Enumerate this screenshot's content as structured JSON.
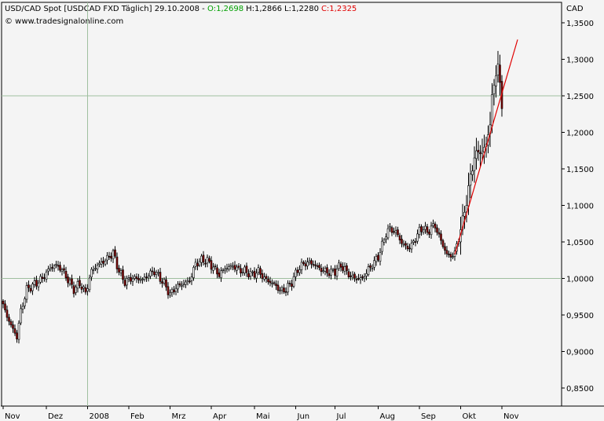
{
  "header": {
    "symbol": "USD/CAD Spot [USDCAD FXD  Täglich] 29.10.2008 -",
    "open_label": "O:",
    "open": "1,2698",
    "high_label": "H:",
    "high": "1,2866",
    "low_label": "L:",
    "low": "1,2280",
    "close_label": "C:",
    "close": "1,2325",
    "source": "© www.tradesignalonline.com"
  },
  "colors": {
    "up": "#ffffff",
    "down": "#8b0000",
    "open": "#00a000",
    "close": "#e00000",
    "trendline": "#e00000",
    "gridline": "#9fbf9f"
  },
  "chart_data": {
    "type": "candlestick",
    "title": "USD/CAD Spot [USDCAD FXD  Täglich] 29.10.2008",
    "unit": "CAD",
    "yticks": [
      "1,3500",
      "1,3000",
      "1,2500",
      "1,2000",
      "1,1500",
      "1,1000",
      "1,0500",
      "1,0000",
      "0,9500",
      "0,9000",
      "0,8500"
    ],
    "ytick_values": [
      1.35,
      1.3,
      1.25,
      1.2,
      1.15,
      1.1,
      1.05,
      1.0,
      0.95,
      0.9,
      0.85
    ],
    "ylim": [
      0.825,
      1.375
    ],
    "xlabels": [
      "Nov",
      "Dez",
      "2008",
      "Feb",
      "Mrz",
      "Apr",
      "Mai",
      "Jun",
      "Jul",
      "Aug",
      "Sep",
      "Okt",
      "Nov"
    ],
    "xlabel_index": [
      0,
      22,
      43,
      64,
      85,
      106,
      128,
      149,
      169,
      191,
      212,
      233,
      254
    ],
    "gridlines_y": [
      1.0,
      1.25
    ],
    "gridline_x_label": "2008",
    "trendline": {
      "from": {
        "x": 230,
        "y": 1.033
      },
      "to": {
        "x": 262,
        "y": 1.327
      }
    },
    "anchors": [
      [
        0,
        0.963
      ],
      [
        2,
        0.948
      ],
      [
        5,
        0.93
      ],
      [
        7,
        0.92
      ],
      [
        9,
        0.955
      ],
      [
        12,
        0.985
      ],
      [
        15,
        0.99
      ],
      [
        20,
        1.0
      ],
      [
        24,
        1.015
      ],
      [
        27,
        1.018
      ],
      [
        30,
        1.012
      ],
      [
        33,
        0.998
      ],
      [
        36,
        0.985
      ],
      [
        39,
        0.993
      ],
      [
        42,
        0.98
      ],
      [
        45,
        1.01
      ],
      [
        48,
        1.018
      ],
      [
        52,
        1.025
      ],
      [
        54,
        1.03
      ],
      [
        56,
        1.035
      ],
      [
        59,
        1.01
      ],
      [
        62,
        0.995
      ],
      [
        65,
        1.0
      ],
      [
        68,
        1.0
      ],
      [
        71,
        0.998
      ],
      [
        74,
        1.005
      ],
      [
        77,
        1.01
      ],
      [
        80,
        1.0
      ],
      [
        82,
        0.993
      ],
      [
        85,
        0.978
      ],
      [
        88,
        0.988
      ],
      [
        91,
        0.992
      ],
      [
        95,
        0.997
      ],
      [
        98,
        1.02
      ],
      [
        101,
        1.025
      ],
      [
        104,
        1.024
      ],
      [
        107,
        1.015
      ],
      [
        110,
        1.005
      ],
      [
        113,
        1.014
      ],
      [
        117,
        1.017
      ],
      [
        120,
        1.012
      ],
      [
        123,
        1.01
      ],
      [
        127,
        1.005
      ],
      [
        130,
        1.01
      ],
      [
        133,
        1.0
      ],
      [
        136,
        0.995
      ],
      [
        139,
        0.99
      ],
      [
        141,
        0.983
      ],
      [
        144,
        0.985
      ],
      [
        147,
        0.995
      ],
      [
        150,
        1.012
      ],
      [
        153,
        1.02
      ],
      [
        156,
        1.022
      ],
      [
        159,
        1.018
      ],
      [
        162,
        1.012
      ],
      [
        166,
        1.008
      ],
      [
        169,
        1.01
      ],
      [
        172,
        1.018
      ],
      [
        174,
        1.012
      ],
      [
        177,
        1.003
      ],
      [
        180,
        1.0
      ],
      [
        183,
        1.0
      ],
      [
        186,
        1.012
      ],
      [
        189,
        1.022
      ],
      [
        191,
        1.03
      ],
      [
        193,
        1.045
      ],
      [
        195,
        1.062
      ],
      [
        197,
        1.068
      ],
      [
        199,
        1.065
      ],
      [
        201,
        1.06
      ],
      [
        203,
        1.048
      ],
      [
        206,
        1.042
      ],
      [
        208,
        1.045
      ],
      [
        210,
        1.055
      ],
      [
        212,
        1.065
      ],
      [
        214,
        1.07
      ],
      [
        216,
        1.062
      ],
      [
        218,
        1.07
      ],
      [
        220,
        1.072
      ],
      [
        222,
        1.058
      ],
      [
        224,
        1.045
      ],
      [
        226,
        1.033
      ],
      [
        228,
        1.03
      ],
      [
        230,
        1.035
      ],
      [
        232,
        1.055
      ],
      [
        234,
        1.08
      ],
      [
        236,
        1.105
      ],
      [
        238,
        1.14
      ],
      [
        240,
        1.165
      ],
      [
        242,
        1.175
      ],
      [
        244,
        1.172
      ],
      [
        246,
        1.185
      ],
      [
        248,
        1.21
      ],
      [
        249,
        1.25
      ],
      [
        251,
        1.28
      ],
      [
        252,
        1.292
      ],
      [
        253,
        1.265
      ],
      [
        254,
        1.2325
      ]
    ]
  }
}
